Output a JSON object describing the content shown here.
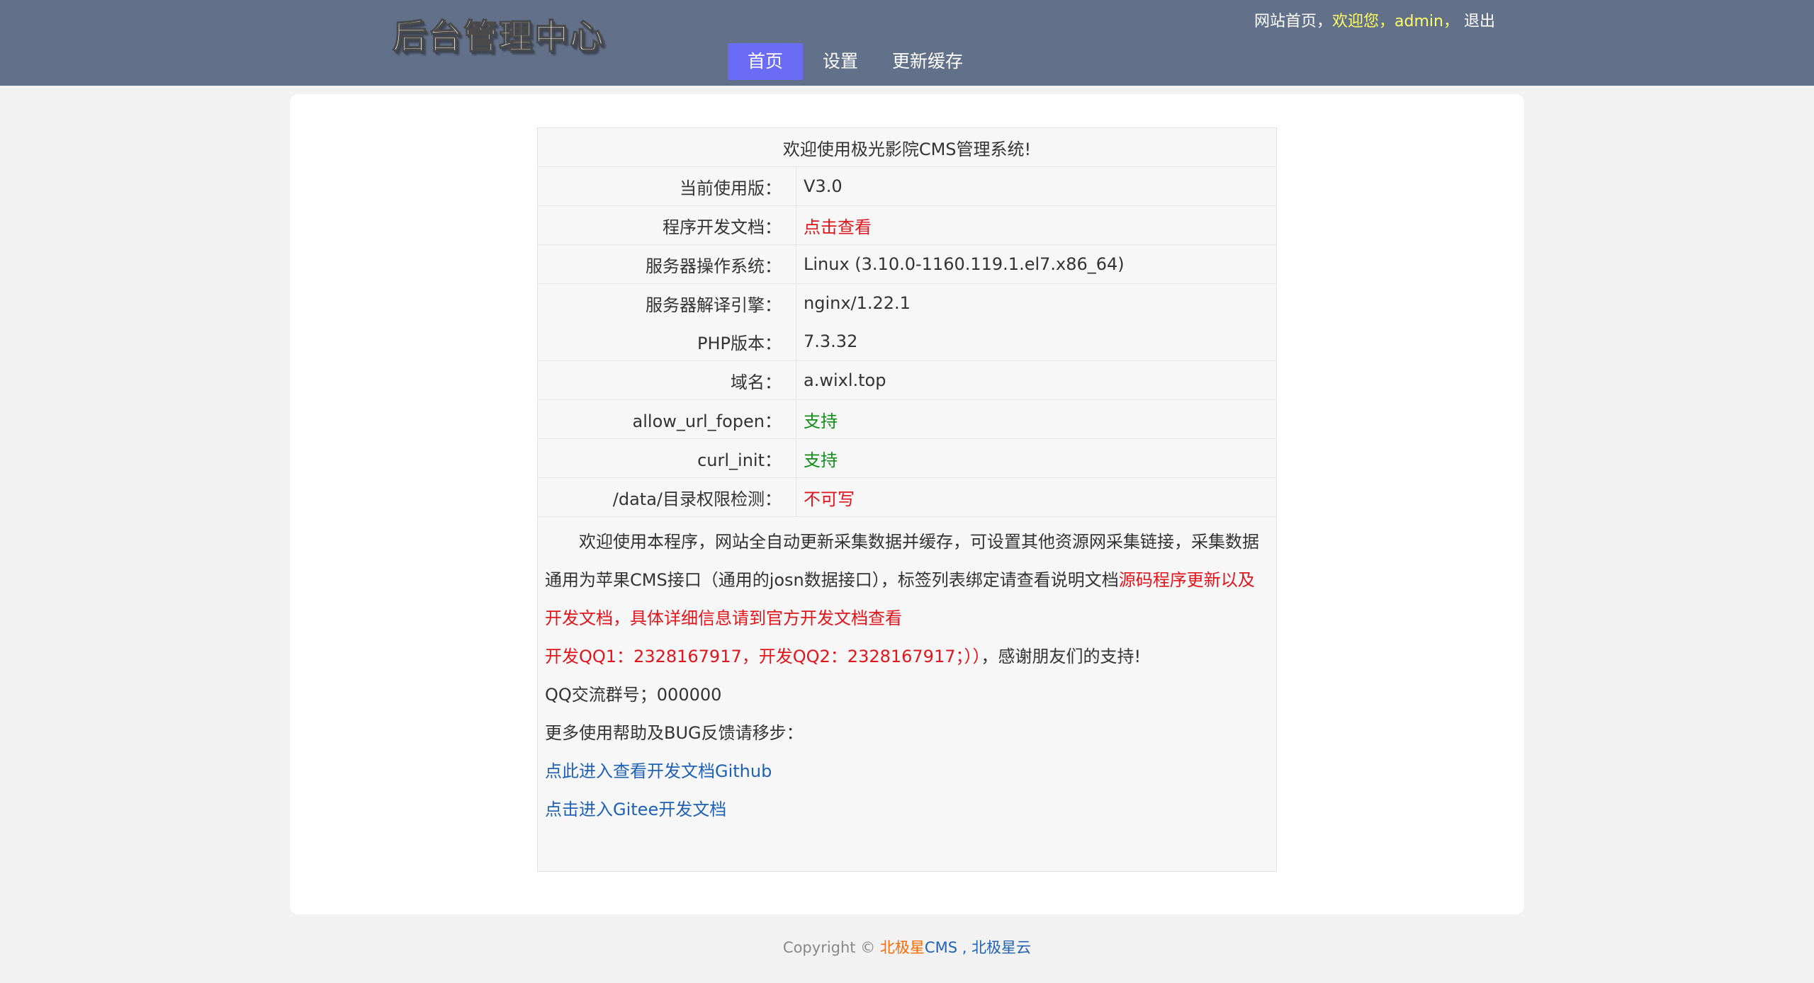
{
  "header": {
    "logo": "后台管理中心",
    "top_links": {
      "home": "网站首页，",
      "welcome": "欢迎您，admin，",
      "logout": "退出"
    },
    "nav": [
      "首页",
      "设置",
      "更新缓存"
    ]
  },
  "info": {
    "title": "欢迎使用极光影院CMS管理系统!",
    "rows": [
      {
        "label": "当前使用版：",
        "value": "V3.0"
      },
      {
        "label": "程序开发文档：",
        "value": "点击查看"
      },
      {
        "label": "服务器操作系统：",
        "value": "Linux (3.10.0-1160.119.1.el7.x86_64)"
      },
      {
        "label": "服务器解译引擎：",
        "value": "nginx/1.22.1"
      },
      {
        "label": "PHP版本：",
        "value": "7.3.32"
      },
      {
        "label": "域名：",
        "value": "a.wixl.top"
      },
      {
        "label": "allow_url_fopen：",
        "value": "支持"
      },
      {
        "label": "curl_init：",
        "value": "支持"
      },
      {
        "label": "/data/目录权限检测：",
        "value": "不可写"
      }
    ],
    "notes": {
      "p1_plain": "欢迎使用本程序，网站全自动更新采集数据并缓存，可设置其他资源网采集链接，采集数据通用为苹果CMS接口（通用的josn数据接口），标签列表绑定请查看说明文档",
      "p1_red": "源码程序更新以及开发文档，具体详细信息请到官方开发文档查看",
      "p2_red": "开发QQ1：2328167917，开发QQ2：2328167917；））",
      "p2_plain": "，感谢朋友们的支持!",
      "p3": "QQ交流群号；000000",
      "p4": "更多使用帮助及BUG反馈请移步：",
      "link1": "点此进入查看开发文档Github",
      "link2": "点击进入Gitee开发文档"
    }
  },
  "footer": {
    "copyright": "Copyright ©",
    "brand1": "北极星",
    "brand2": "CMS",
    "sep": " , ",
    "brand3": "北极星云"
  },
  "colors": {
    "header_bg": "#627089",
    "nav_active": "#6b6cf5",
    "red": "#e0161c",
    "green": "#0f8f15",
    "link": "#1f62b5"
  }
}
